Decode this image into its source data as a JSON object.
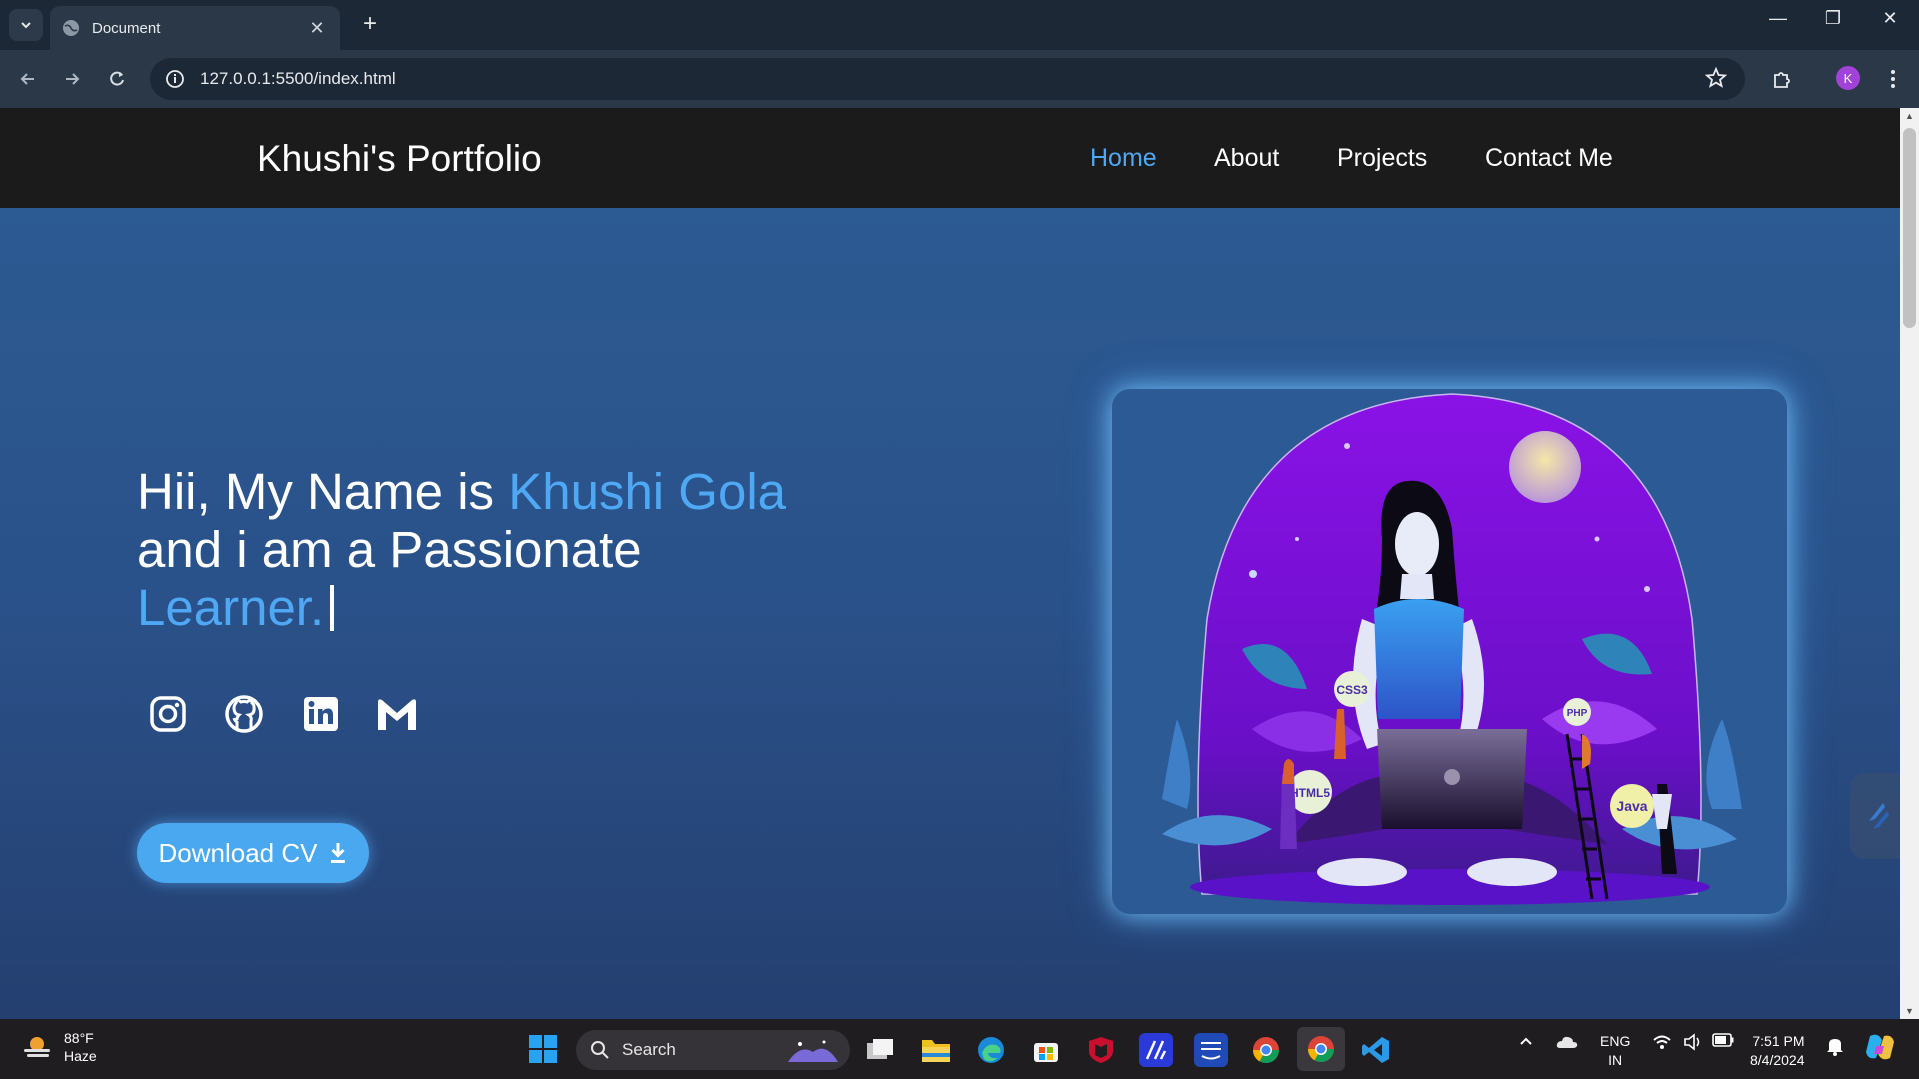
{
  "browser": {
    "tab_title": "Document",
    "url": "127.0.0.1:5500/index.html",
    "profile_initial": "K"
  },
  "site": {
    "brand": "Khushi's Portfolio",
    "nav": [
      "Home",
      "About",
      "Projects",
      "Contact Me"
    ],
    "active_nav": "Home",
    "hero": {
      "line1_plain": "Hii, My Name is ",
      "line1_name": "Khushi Gola",
      "line2": "and i am a Passionate",
      "line3_word": "Learner."
    },
    "social_icons": [
      "instagram-icon",
      "github-icon",
      "linkedin-icon",
      "gmail-icon"
    ],
    "cv_button": "Download CV",
    "illustration_badges": [
      "CSS3",
      "PHP",
      "HTML5",
      "Java"
    ],
    "colors": {
      "accent": "#4fa8f3",
      "header_bg": "#1b1b1b",
      "hero_bg": "#2d5c94",
      "button_bg": "#4aa8f0",
      "illustration_purple": "#8a12e6"
    }
  },
  "taskbar": {
    "weather_temp": "88°F",
    "weather_desc": "Haze",
    "search_label": "Search",
    "lang_top": "ENG",
    "lang_bottom": "IN",
    "time": "7:51 PM",
    "date": "8/4/2024"
  }
}
